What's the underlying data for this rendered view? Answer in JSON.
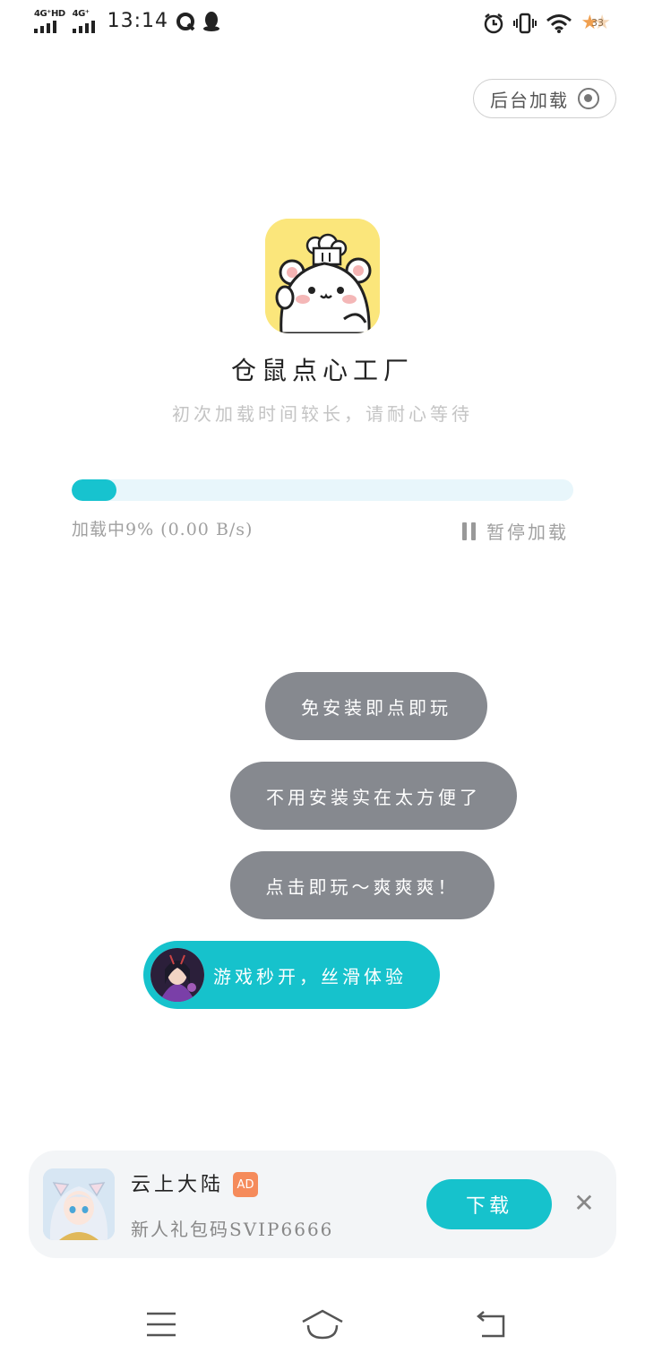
{
  "status_bar": {
    "signal1_label": "4G⁺HD",
    "signal2_label": "4G⁺",
    "time": "13:14",
    "battery_level": "33",
    "icons": [
      "qq-browser-icon",
      "qq-penguin-icon",
      "alarm-icon",
      "vibrate-icon",
      "wifi-icon",
      "battery-star-icon"
    ]
  },
  "header": {
    "background_load_label": "后台加载"
  },
  "app": {
    "name": "仓鼠点心工厂",
    "subtitle": "初次加载时间较长，请耐心等待"
  },
  "progress": {
    "percent": 9,
    "status_text": "加载中9% (0.00 B/s)",
    "pause_label": "暂停加载"
  },
  "bubbles": [
    "免安装即点即玩",
    "不用安装实在太方便了",
    "点击即玩～爽爽爽！",
    "游戏秒开，丝滑体验"
  ],
  "ad": {
    "title": "云上大陆",
    "badge": "AD",
    "subtitle": "新人礼包码SVIP6666",
    "download_label": "下载",
    "close_symbol": "✕"
  },
  "colors": {
    "accent": "#16c2cc",
    "bubble_gray": "#86898f",
    "ad_badge": "#f58b5b",
    "app_icon_bg": "#fbe67b"
  }
}
